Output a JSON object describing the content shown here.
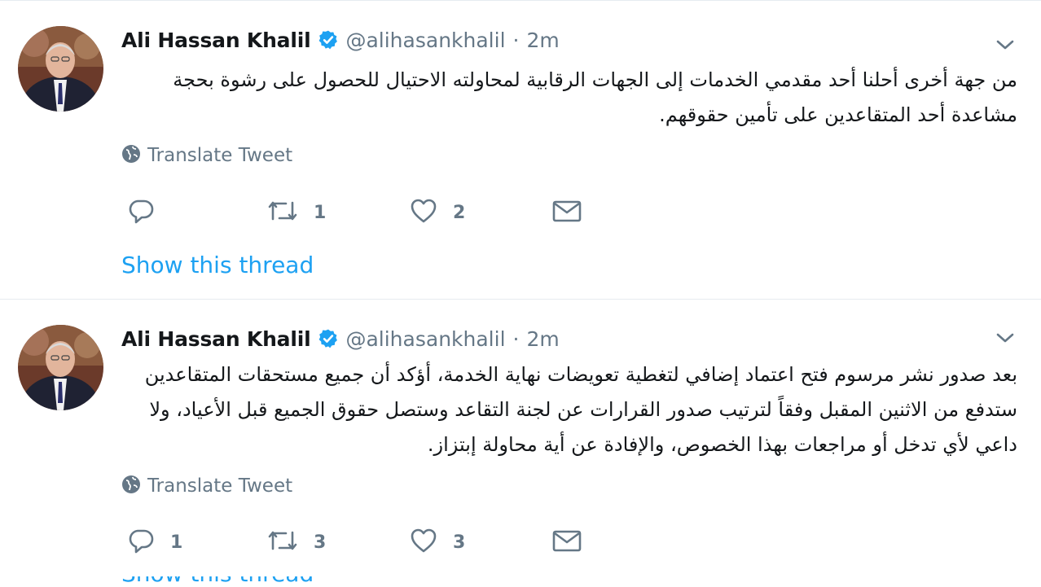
{
  "tweets": [
    {
      "name": "Ali Hassan Khalil",
      "handle": "@alihasankhalil",
      "separator": "·",
      "time": "2m",
      "text_lines": [
        "من جهة أخرى أحلنا أحد مقدمي الخدمات إلى الجهات الرقابية لمحاولته الاحتيال للحصول على رشوة بحجة",
        "مشاعدة أحد المتقاعدين على تأمين حقوقهم."
      ],
      "translate_label": "Translate Tweet",
      "reply_count": "",
      "retweet_count": "1",
      "like_count": "2",
      "show_thread": "Show this thread"
    },
    {
      "name": "Ali Hassan Khalil",
      "handle": "@alihasankhalil",
      "separator": "·",
      "time": "2m",
      "text_lines": [
        "بعد صدور نشر مرسوم فتح اعتماد إضافي لتغطية تعويضات نهاية الخدمة، أؤكد أن جميع مستحقات المتقاعدين",
        "ستدفع من الاثنين المقبل وفقاً لترتيب صدور القرارات عن لجنة التقاعد وستصل حقوق الجميع قبل الأعياد، ولا",
        "داعي لأي تدخل أو مراجعات بهذا الخصوص، والإفادة عن أية محاولة إبتزاز."
      ],
      "translate_label": "Translate Tweet",
      "reply_count": "1",
      "retweet_count": "3",
      "like_count": "3",
      "show_thread": "Show this thread"
    }
  ],
  "icons": {
    "verified": "verified-badge-icon",
    "caret": "chevron-down-icon",
    "globe": "globe-icon",
    "reply": "reply-icon",
    "retweet": "retweet-icon",
    "like": "heart-icon",
    "message": "envelope-icon"
  },
  "colors": {
    "accent": "#1da1f2",
    "secondary_text": "#657786",
    "primary_text": "#14171a",
    "border": "#e6ecf0"
  }
}
